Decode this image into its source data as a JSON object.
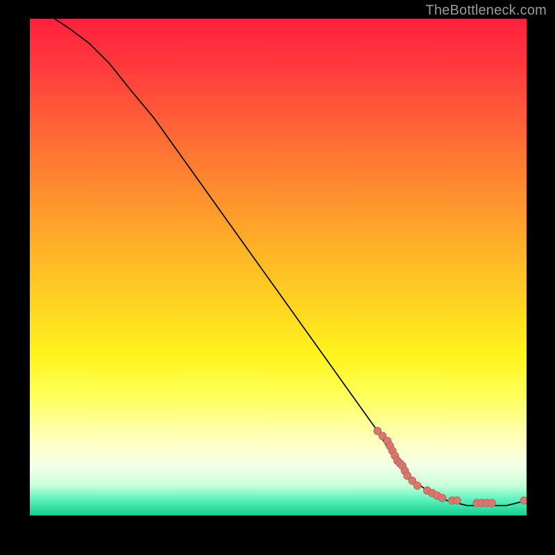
{
  "watermark": "TheBottleneck.com",
  "chart_data": {
    "type": "line",
    "title": "",
    "xlabel": "",
    "ylabel": "",
    "xlim": [
      0,
      100
    ],
    "ylim": [
      0,
      100
    ],
    "series": [
      {
        "name": "curve",
        "x": [
          5,
          8,
          12,
          16,
          20,
          25,
          30,
          35,
          40,
          45,
          50,
          55,
          60,
          65,
          70,
          73,
          76,
          80,
          84,
          88,
          92,
          96,
          100
        ],
        "y": [
          100,
          98,
          95,
          91,
          86,
          80,
          73,
          66,
          59,
          52,
          45,
          38,
          31,
          24,
          17,
          12,
          8,
          5,
          3,
          2,
          2,
          2,
          3
        ]
      }
    ],
    "points": {
      "name": "marked-points",
      "x": [
        70,
        71,
        72,
        72.5,
        73,
        73.5,
        74,
        74.5,
        75,
        75.5,
        76,
        77,
        78,
        80,
        81,
        82,
        83,
        85,
        86,
        90,
        91,
        92,
        93,
        99.5
      ],
      "y": [
        17,
        16,
        15,
        14,
        13,
        12,
        11,
        10.5,
        10,
        9,
        8,
        7,
        6,
        5,
        4.5,
        4,
        3.5,
        3,
        3,
        2.5,
        2.5,
        2.5,
        2.5,
        3
      ]
    },
    "colors": {
      "curve": "#000000",
      "points_fill": "#d6786f",
      "points_stroke": "#b95e56"
    }
  }
}
